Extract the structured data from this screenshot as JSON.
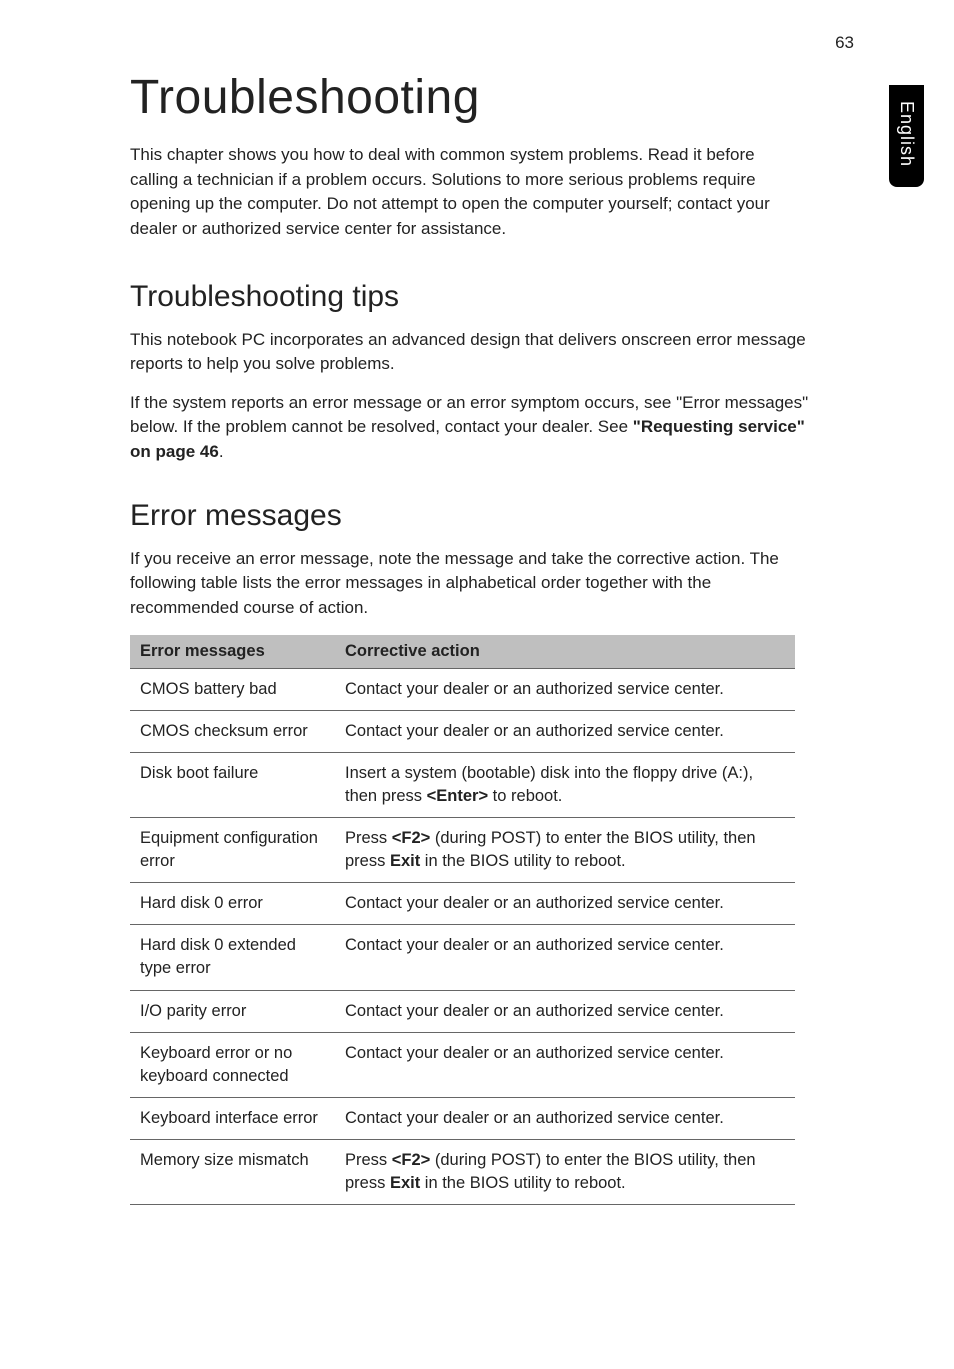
{
  "page_number": "63",
  "side_tab": "English",
  "title": "Troubleshooting",
  "intro": "This chapter shows you how to deal with common system problems. Read it before calling a technician if a problem occurs. Solutions to more serious problems require opening up the computer. Do not attempt to open the computer yourself; contact your dealer or authorized service center for assistance.",
  "tips_heading": "Troubleshooting tips",
  "tips_p1": "This notebook PC incorporates an advanced design that delivers onscreen error message reports to help you solve problems.",
  "tips_p2_a": "If the system reports an error message or an error symptom occurs, see \"Error messages\" below. If the problem cannot be resolved, contact your dealer. See ",
  "tips_p2_b": "\"Requesting service\" on page 46",
  "tips_p2_c": ".",
  "err_heading": "Error messages",
  "err_intro": "If you receive an error message, note the message and take the corrective action. The following table lists the error messages in alphabetical order together with the recommended course of action.",
  "table": {
    "head": {
      "c1": "Error messages",
      "c2": "Corrective action"
    },
    "rows": [
      {
        "c1": "CMOS battery bad",
        "c2_parts": [
          [
            "",
            "Contact your dealer or an authorized service center."
          ]
        ]
      },
      {
        "c1": "CMOS checksum error",
        "c2_parts": [
          [
            "",
            "Contact your dealer or an authorized service center."
          ]
        ]
      },
      {
        "c1": "Disk boot failure",
        "c2_parts": [
          [
            "",
            "Insert a system (bootable) disk into the floppy drive (A:), then press "
          ],
          [
            "b",
            "<Enter>"
          ],
          [
            "",
            " to reboot."
          ]
        ]
      },
      {
        "c1": "Equipment configuration error",
        "c2_parts": [
          [
            "",
            "Press "
          ],
          [
            "b",
            "<F2>"
          ],
          [
            "",
            " (during POST) to enter the BIOS utility, then press "
          ],
          [
            "b",
            "Exit"
          ],
          [
            "",
            " in the BIOS utility to reboot."
          ]
        ]
      },
      {
        "c1": "Hard disk 0 error",
        "c2_parts": [
          [
            "",
            "Contact your dealer or an authorized service center."
          ]
        ]
      },
      {
        "c1": "Hard disk 0 extended type error",
        "c2_parts": [
          [
            "",
            "Contact your dealer or an authorized service center."
          ]
        ]
      },
      {
        "c1": "I/O parity error",
        "c2_parts": [
          [
            "",
            "Contact your dealer or an authorized service center."
          ]
        ]
      },
      {
        "c1": "Keyboard error or no keyboard connected",
        "c2_parts": [
          [
            "",
            "Contact your dealer or an authorized service center."
          ]
        ]
      },
      {
        "c1": "Keyboard interface error",
        "c2_parts": [
          [
            "",
            "Contact your dealer or an authorized service center."
          ]
        ]
      },
      {
        "c1": "Memory size mismatch",
        "c2_parts": [
          [
            "",
            "Press "
          ],
          [
            "b",
            "<F2>"
          ],
          [
            "",
            " (during POST) to enter the BIOS utility, then press "
          ],
          [
            "b",
            "Exit"
          ],
          [
            "",
            " in the BIOS utility to reboot."
          ]
        ]
      }
    ]
  }
}
